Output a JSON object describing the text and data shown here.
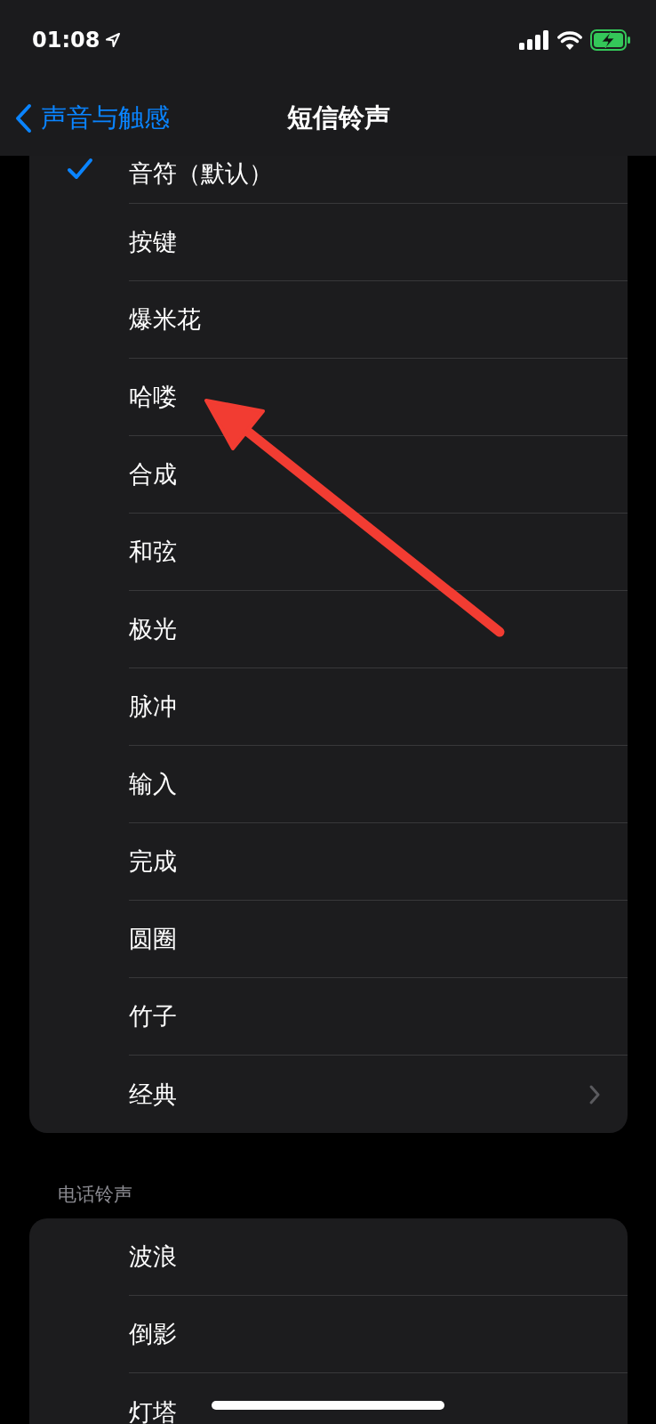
{
  "status_bar": {
    "time": "01:08"
  },
  "nav": {
    "back": "声音与触感",
    "title": "短信铃声"
  },
  "tones": [
    {
      "label": "音符（默认）",
      "selected": true,
      "kind": "tone"
    },
    {
      "label": "按键",
      "selected": false,
      "kind": "tone"
    },
    {
      "label": "爆米花",
      "selected": false,
      "kind": "tone"
    },
    {
      "label": "哈喽",
      "selected": false,
      "kind": "tone"
    },
    {
      "label": "合成",
      "selected": false,
      "kind": "tone"
    },
    {
      "label": "和弦",
      "selected": false,
      "kind": "tone"
    },
    {
      "label": "极光",
      "selected": false,
      "kind": "tone"
    },
    {
      "label": "脉冲",
      "selected": false,
      "kind": "tone"
    },
    {
      "label": "输入",
      "selected": false,
      "kind": "tone"
    },
    {
      "label": "完成",
      "selected": false,
      "kind": "tone"
    },
    {
      "label": "圆圈",
      "selected": false,
      "kind": "tone"
    },
    {
      "label": "竹子",
      "selected": false,
      "kind": "tone"
    },
    {
      "label": "经典",
      "selected": false,
      "kind": "link"
    }
  ],
  "ringtones": {
    "header": "电话铃声",
    "items": [
      {
        "label": "波浪",
        "selected": false,
        "kind": "tone"
      },
      {
        "label": "倒影",
        "selected": false,
        "kind": "tone"
      },
      {
        "label": "灯塔",
        "selected": false,
        "kind": "tone"
      }
    ]
  }
}
